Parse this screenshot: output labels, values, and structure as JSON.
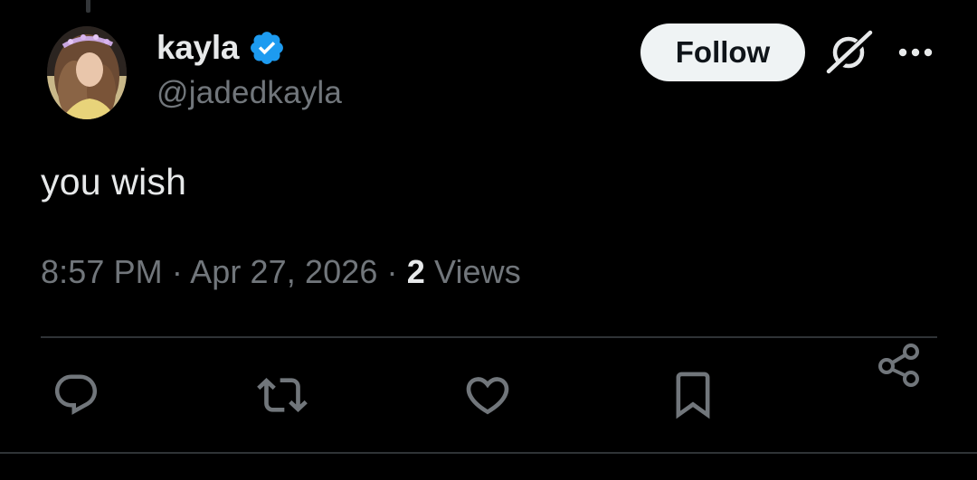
{
  "author": {
    "display_name": "kayla",
    "handle": "@jadedkayla",
    "verified": true,
    "avatar_icon": "profile-photo"
  },
  "header": {
    "follow_label": "Follow",
    "grok_icon": "grok-icon",
    "more_icon": "more-options-icon"
  },
  "tweet": {
    "text": "you wish",
    "time": "8:57 PM",
    "separator1": " · ",
    "date": "Apr 27, 2026",
    "separator2": " · ",
    "views_count": "2",
    "views_label": " Views"
  },
  "actions": {
    "reply_icon": "reply-icon",
    "retweet_icon": "retweet-icon",
    "like_icon": "heart-icon",
    "bookmark_icon": "bookmark-icon",
    "share_icon": "share-icon"
  },
  "colors": {
    "background": "#000000",
    "primary_text": "#e7e9ea",
    "secondary_text": "#71767b",
    "verified_blue": "#1d9bf0",
    "follow_bg": "#eff3f4",
    "divider": "#2f3336"
  }
}
